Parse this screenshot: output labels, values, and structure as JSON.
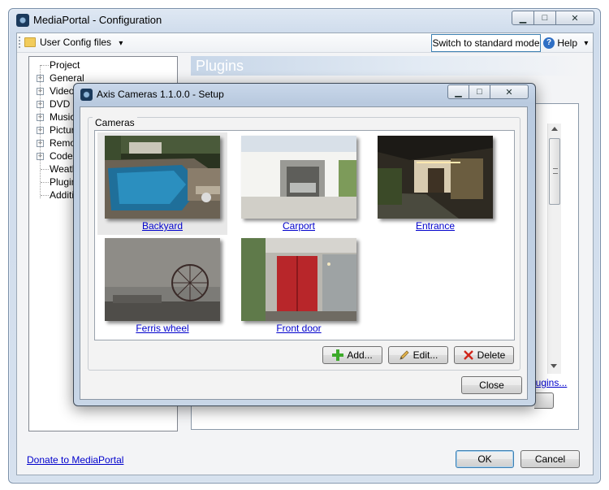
{
  "main_window": {
    "title": "MediaPortal - Configuration",
    "minimize_glyph": "▁",
    "maximize_glyph": "□",
    "close_glyph": "✕"
  },
  "toolbar": {
    "user_config_label": "User Config files",
    "dropdown_glyph": "▾",
    "switch_mode_label": "Switch to standard mode",
    "help_label": "Help",
    "help_glyph": "?"
  },
  "tree": {
    "items": [
      {
        "label": "Project",
        "expandable": false
      },
      {
        "label": "General",
        "expandable": true
      },
      {
        "label": "Videos",
        "expandable": true
      },
      {
        "label": "DVD D",
        "expandable": true
      },
      {
        "label": "Music",
        "expandable": true
      },
      {
        "label": "Picture",
        "expandable": true
      },
      {
        "label": "Remot",
        "expandable": true
      },
      {
        "label": "Codec",
        "expandable": true
      },
      {
        "label": "Weath",
        "expandable": false
      },
      {
        "label": "Plugin",
        "expandable": false
      },
      {
        "label": "Additio",
        "expandable": false
      }
    ],
    "expand_glyph": "+"
  },
  "right_pane": {
    "header": "Plugins",
    "plugins_link": "lugins..."
  },
  "bottom": {
    "donate_link": "Donate to MediaPortal",
    "ok_label": "OK",
    "cancel_label": "Cancel"
  },
  "dialog": {
    "title": "Axis Cameras 1.1.0.0 - Setup",
    "group_label": "Cameras",
    "cameras": [
      {
        "name": "Backyard",
        "selected": true
      },
      {
        "name": "Carport",
        "selected": false
      },
      {
        "name": "Entrance",
        "selected": false
      },
      {
        "name": "Ferris wheel",
        "selected": false
      },
      {
        "name": "Front door",
        "selected": false
      }
    ],
    "add_label": "Add...",
    "edit_label": "Edit...",
    "delete_label": "Delete",
    "close_label": "Close",
    "minimize_glyph": "▁",
    "maximize_glyph": "□",
    "close_glyph": "✕"
  },
  "colors": {
    "link": "#0000cc",
    "add_icon": "#3caa2a",
    "delete_icon": "#d0261b"
  }
}
